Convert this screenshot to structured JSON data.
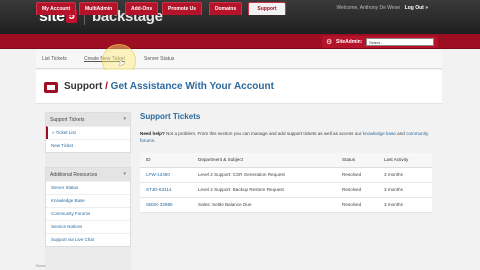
{
  "header": {
    "logo_site": "site",
    "logo_five": "5",
    "logo_backstage": "backstage",
    "welcome": "Welcome, Anthony De Wese",
    "logout": "Log Out »"
  },
  "nav": {
    "tabs": [
      "My Account",
      "MultiAdmin",
      "Add-Ons",
      "Promote Us",
      "Domains",
      "Support"
    ],
    "active": "Support",
    "siteadmin_label": "SiteAdmin:",
    "siteadmin_select": "Select -"
  },
  "subnav": {
    "items": [
      "List Tickets",
      "Create New Ticket",
      "Server Status"
    ]
  },
  "page": {
    "title": "Support",
    "separator": "/",
    "subtitle": "Get Assistance With Your Account"
  },
  "sidebar": {
    "support_tickets_header": "Support Tickets",
    "support_items": [
      "» Ticket List",
      "New Ticket"
    ],
    "additional_header": "Additional Resources",
    "additional_items": [
      "Server Status",
      "Knowledge Base",
      "Community Forums",
      "Service Notices",
      "Support via Live Chat"
    ]
  },
  "main": {
    "title": "Support Tickets",
    "help_bold": "Need help?",
    "help_text_1": " Not a problem. From this section you can manage and add support tickets as well as access our",
    "kb_link": "knowledge base",
    "and": " and ",
    "forums_link": "community forums",
    "period": "."
  },
  "table": {
    "headers": [
      "ID",
      "Department & Subject",
      "Status",
      "Last Activity"
    ],
    "rows": [
      [
        "LFW-12480",
        "Level 2 Support: CSR Generation Request",
        "Resolved",
        "3 months"
      ],
      [
        "STJD-63114",
        "Level 2 Support: Backup Restore Request",
        "Resolved",
        "3 months"
      ],
      [
        "SBSK-32995",
        "Sales: Settle Balance Due",
        "Resolved",
        "3 months"
      ]
    ]
  },
  "status_bar": "Done"
}
